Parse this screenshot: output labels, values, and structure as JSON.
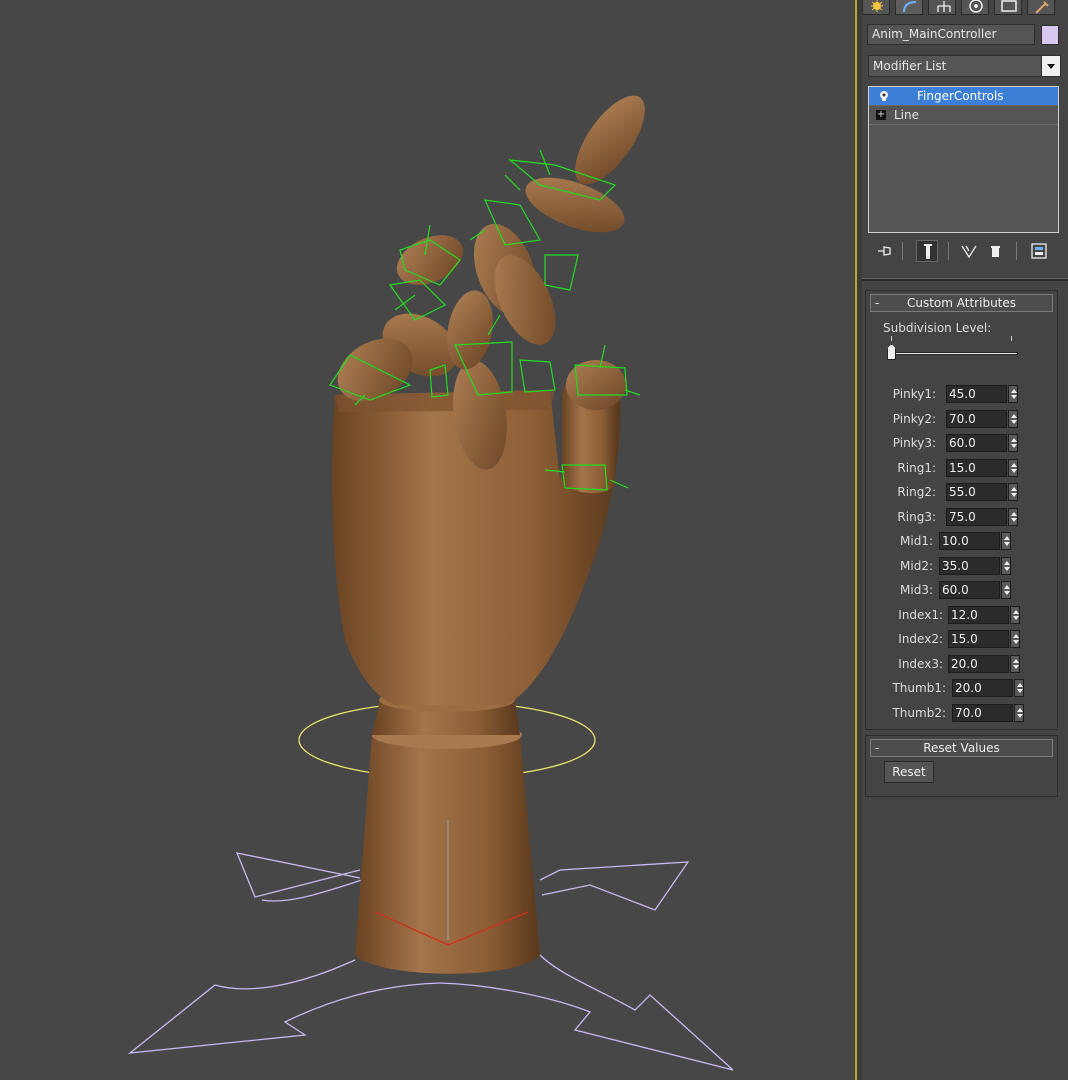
{
  "command_panel": {
    "tabs": [
      {
        "name": "create-tab"
      },
      {
        "name": "modify-tab"
      },
      {
        "name": "hierarchy-tab"
      },
      {
        "name": "motion-tab"
      },
      {
        "name": "display-tab"
      },
      {
        "name": "utilities-tab"
      }
    ],
    "object_name": "Anim_MainController",
    "object_color": "#d8c8f0",
    "modifier_list": "Modifier List",
    "stack": [
      {
        "label": "FingerControls",
        "selected": true,
        "icon": "lightbulb-icon"
      },
      {
        "label": "Line",
        "selected": false,
        "icon": "expand-plus-icon"
      }
    ]
  },
  "custom_attributes": {
    "title": "Custom Attributes",
    "collapse_symbol": "-",
    "subdivision_label": "Subdivision Level:",
    "subdivision_value": 0,
    "params": [
      {
        "label": "Pinky1:",
        "value": "45.0"
      },
      {
        "label": "Pinky2:",
        "value": "70.0"
      },
      {
        "label": "Pinky3:",
        "value": "60.0"
      },
      {
        "label": "Ring1:",
        "value": "15.0"
      },
      {
        "label": "Ring2:",
        "value": "55.0"
      },
      {
        "label": "Ring3:",
        "value": "75.0"
      },
      {
        "label": "Mid1:",
        "value": "10.0"
      },
      {
        "label": "Mid2:",
        "value": "35.0"
      },
      {
        "label": "Mid3:",
        "value": "60.0"
      },
      {
        "label": "Index1:",
        "value": "12.0"
      },
      {
        "label": "Index2:",
        "value": "15.0"
      },
      {
        "label": "Index3:",
        "value": "20.0"
      },
      {
        "label": "Thumb1:",
        "value": "20.0"
      },
      {
        "label": "Thumb2:",
        "value": "70.0"
      }
    ]
  },
  "reset_values": {
    "title": "Reset Values",
    "collapse_symbol": "-",
    "button": "Reset"
  },
  "colors": {
    "viewport_bg": "#474747",
    "wood": "#9b6a3e",
    "bone_wire": "#22dd22",
    "control_circle": "#e8e86a",
    "arrow_control": "#c8b8f0",
    "selection_blue": "#3d7ed6",
    "panel_accent": "#bfa828"
  }
}
